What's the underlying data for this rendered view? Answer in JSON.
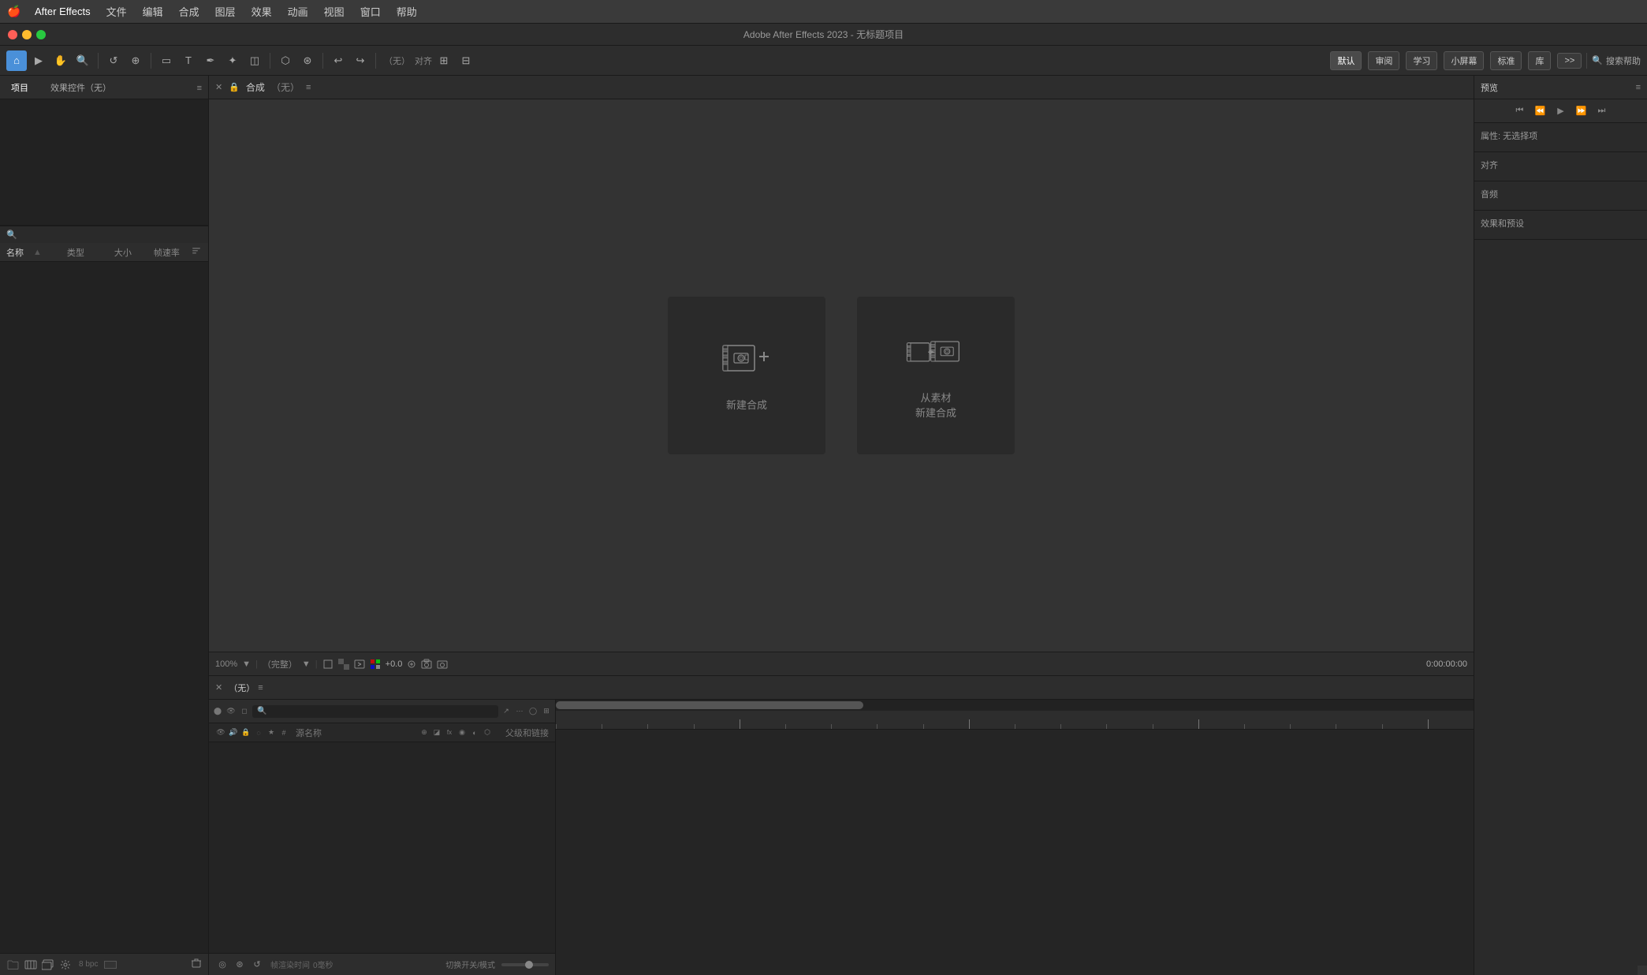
{
  "app": {
    "name": "After Effects",
    "title": "Adobe After Effects 2023 - 无标题项目",
    "version": "2023"
  },
  "menubar": {
    "apple": "🍎",
    "items": [
      {
        "label": "After Effects",
        "active": true
      },
      {
        "label": "文件"
      },
      {
        "label": "编辑"
      },
      {
        "label": "合成"
      },
      {
        "label": "图层"
      },
      {
        "label": "效果"
      },
      {
        "label": "动画"
      },
      {
        "label": "视图"
      },
      {
        "label": "窗口"
      },
      {
        "label": "帮助"
      }
    ]
  },
  "workspace": {
    "items": [
      {
        "label": "默认",
        "active": true
      },
      {
        "label": "审阅"
      },
      {
        "label": "学习"
      },
      {
        "label": "小屏幕"
      },
      {
        "label": "标准"
      },
      {
        "label": "库"
      },
      {
        "label": ">>"
      }
    ]
  },
  "search_help": {
    "icon": "🔍",
    "label": "搜索帮助"
  },
  "left_panel": {
    "project_tab": "项目",
    "effects_tab": "效果控件（无）",
    "search_placeholder": "",
    "columns": {
      "name": "名称",
      "type": "类型",
      "size": "大小",
      "framerate": "帧速率"
    },
    "footer": {
      "bpc": "8 bpc"
    }
  },
  "viewport": {
    "tab_name": "合成",
    "tab_qualifier": "（无）",
    "zoom": "100%",
    "quality": "（完整）",
    "timecode": "0:00:00:00",
    "new_comp_card": {
      "label": "新建合成"
    },
    "from_footage_card": {
      "label": "从素材\n新建合成"
    }
  },
  "timeline": {
    "tab_name": "（无）",
    "search_placeholder": "",
    "columns": {
      "source_name": "源名称",
      "parent_link": "父级和链接"
    },
    "timecode": "帧渲染时间",
    "framerate_label": "0毫秒",
    "switch_label": "切换开关/模式"
  },
  "right_panel": {
    "preview_title": "预览",
    "attrs_title": "属性: 无选择项",
    "align_title": "对齐",
    "audio_title": "音频",
    "effects_presets_title": "效果和预设"
  },
  "colors": {
    "bg_dark": "#222222",
    "bg_panel": "#2a2a2a",
    "bg_toolbar": "#2d2d2d",
    "accent_blue": "#4a90d9",
    "timeline_bar": "#4a90d9",
    "text_primary": "#cccccc",
    "text_secondary": "#888888",
    "border": "#1a1a1a"
  }
}
